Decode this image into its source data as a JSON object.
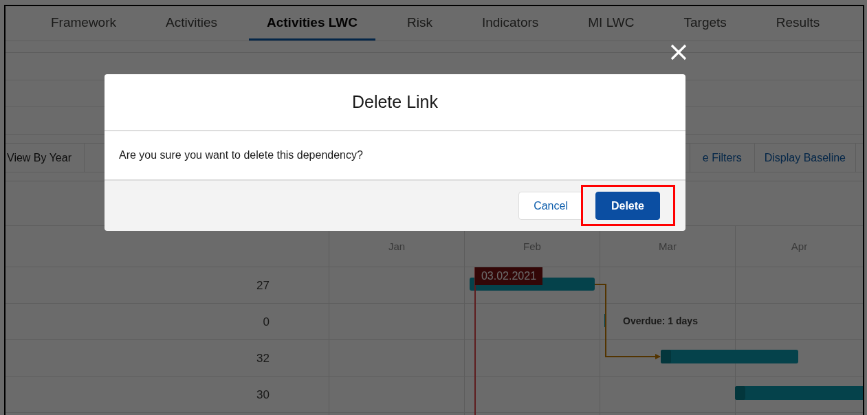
{
  "tabs": [
    {
      "label": "Framework",
      "selected": false
    },
    {
      "label": "Activities",
      "selected": false
    },
    {
      "label": "Activities LWC",
      "selected": true
    },
    {
      "label": "Risk",
      "selected": false
    },
    {
      "label": "Indicators",
      "selected": false
    },
    {
      "label": "MI LWC",
      "selected": false
    },
    {
      "label": "Targets",
      "selected": false
    },
    {
      "label": "Results",
      "selected": false
    }
  ],
  "toolbar": {
    "view_button": "View By Year",
    "filters_button": "e Filters",
    "baseline_button": "Display Baseline"
  },
  "gantt": {
    "months": [
      "Jan",
      "Feb",
      "Mar",
      "Apr"
    ],
    "rows": [
      {
        "value": "27"
      },
      {
        "value": "0"
      },
      {
        "value": "32"
      },
      {
        "value": "30"
      }
    ],
    "today_label": "03.02.2021",
    "overdue_label": "Overdue: 1 days"
  },
  "modal": {
    "title": "Delete Link",
    "message": "Are you sure you want to delete this dependency?",
    "cancel": "Cancel",
    "confirm": "Delete",
    "confirm_highlighted": true
  }
}
